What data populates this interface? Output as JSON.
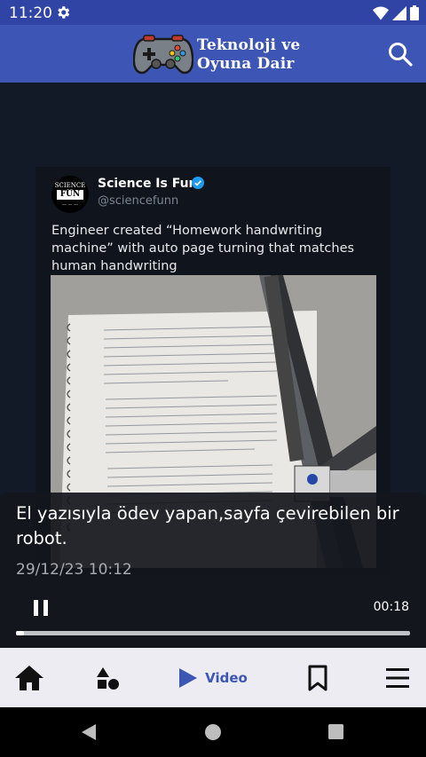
{
  "status_bar": {
    "time": "11:20"
  },
  "app_bar": {
    "logo_line1": "Teknoloji ve",
    "logo_line2": "Oyuna Dair"
  },
  "tweet": {
    "avatar_text": "SCIENCE IS FUN",
    "name": "Science Is Fun",
    "handle": "@sciencefunn",
    "body": "Engineer created “Homework handwriting machine” with auto page turning that matches human handwriting"
  },
  "player": {
    "caption": "El yazısıyla ödev yapan,sayfa çevirebilen bir robot.",
    "date": "29/12/23 10:12",
    "duration": "00:18",
    "progress_fraction": 0.02
  },
  "bottom_nav": {
    "items": [
      {
        "name": "home",
        "label": ""
      },
      {
        "name": "categories",
        "label": ""
      },
      {
        "name": "video",
        "label": "Video"
      },
      {
        "name": "bookmarks",
        "label": ""
      },
      {
        "name": "menu",
        "label": ""
      }
    ]
  },
  "colors": {
    "primary": "#3d55b5",
    "status_bar": "#2f44a4",
    "background": "#101722",
    "nav_bg": "#ececf2"
  },
  "icons": [
    "gear-icon",
    "wifi-icon",
    "signal-icon",
    "battery-icon",
    "search-icon",
    "verified-icon",
    "pause-icon",
    "home-icon",
    "shapes-icon",
    "play-icon",
    "bookmark-icon",
    "menu-icon",
    "back-icon",
    "home-circle-icon",
    "recents-icon"
  ]
}
